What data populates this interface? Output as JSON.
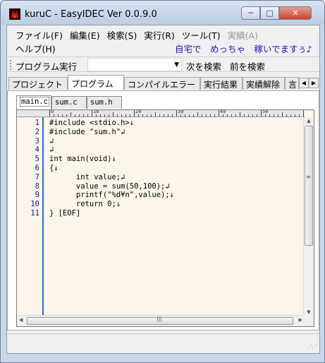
{
  "window": {
    "title": "kuruC - EasyIDEC Ver 0.0.9.0",
    "minimize": "─",
    "maximize": "□",
    "close": "✕"
  },
  "menu": {
    "row1": [
      "ファイル(F)",
      "編集(E)",
      "検索(S)",
      "実行(R)",
      "ツール(T)"
    ],
    "row1_disabled": "実績(A)",
    "row2": [
      "ヘルプ(H)"
    ],
    "slogan": "自宅で　めっちゃ　稼いでますぅ♪"
  },
  "toolbar": {
    "run_label": "プログラム実行",
    "combo_value": "",
    "search_next": "次を検索",
    "search_prev": "前を検索"
  },
  "tabs": [
    "プロジェクト",
    "プログラム",
    "コンパイルエラー",
    "実行結果",
    "実績解除",
    "言"
  ],
  "active_tab": "プログラム",
  "file_tabs": [
    "main.c",
    "sum.c",
    "sum.h"
  ],
  "active_file": "main.c",
  "ruler_numbers": [
    "0",
    "10",
    "20",
    "30",
    "40",
    "50"
  ],
  "editor": {
    "line_numbers": [
      "1",
      "2",
      "3",
      "4",
      "5",
      "6",
      "7",
      "8",
      "9",
      "10",
      "11"
    ],
    "lines": [
      "#include <stdio.h>↓",
      "#include \"sum.h\"↲",
      "↲",
      "↲",
      "int main(void)↓",
      "{↓",
      "      int value;↲",
      "      value = sum(50,100);↲",
      "      printf(\"%d¥n\",value);↓",
      "      return 0;↓",
      "} [EOF]"
    ]
  },
  "colors": {
    "line_number": "#1515a0",
    "gutter_border": "#1e6fc8",
    "editor_bg": "#fbf5ea",
    "slogan": "#1515c0"
  },
  "icons": {
    "app": "kuruc-app-icon",
    "combo_arrow": "▼",
    "tab_left": "◀",
    "tab_right": "▶",
    "scroll_up": "▲",
    "scroll_down": "▼",
    "scroll_left": "◀",
    "scroll_right": "▶"
  }
}
